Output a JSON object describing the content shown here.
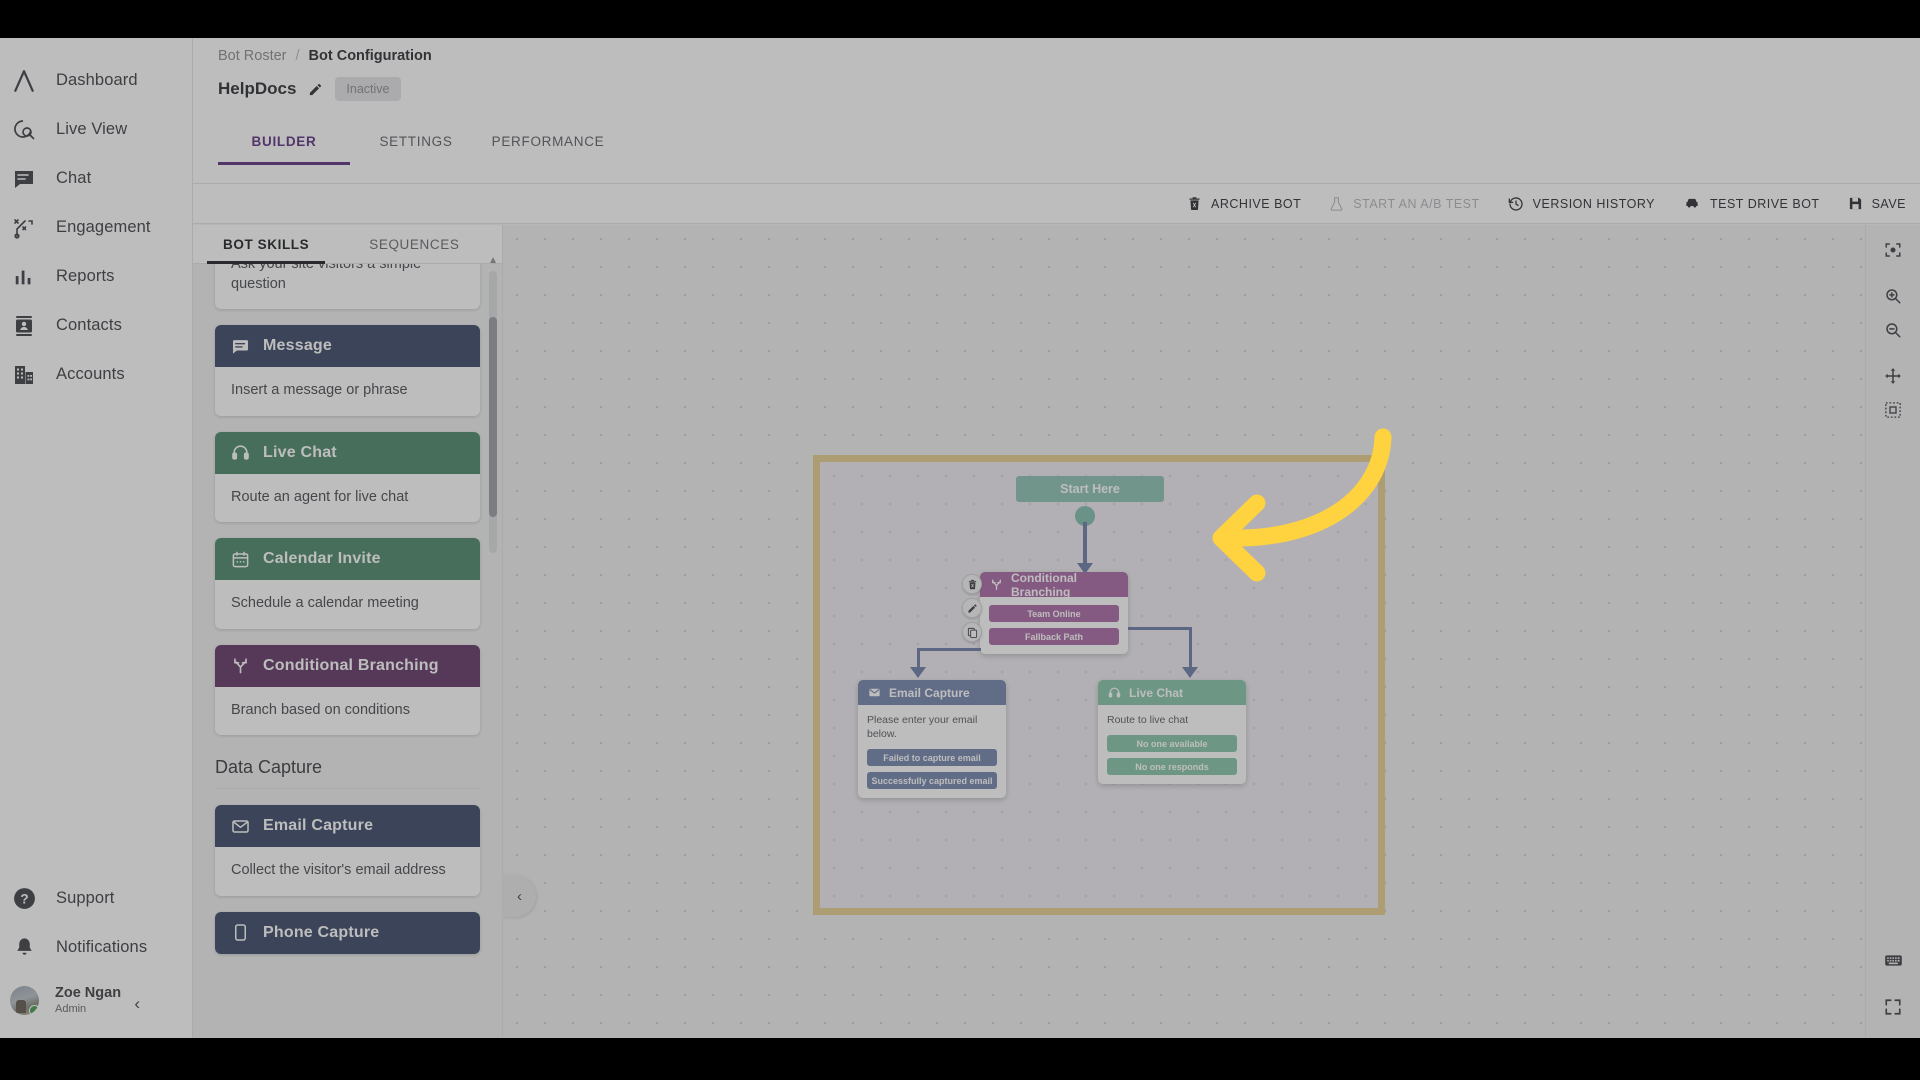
{
  "sidebar": {
    "nav_items": [
      {
        "label": "Dashboard",
        "icon": "logo-caret-icon"
      },
      {
        "label": "Live View",
        "icon": "live-view-icon"
      },
      {
        "label": "Chat",
        "icon": "chat-bubble-icon"
      },
      {
        "label": "Engagement",
        "icon": "engagement-icon"
      },
      {
        "label": "Reports",
        "icon": "bar-chart-icon"
      },
      {
        "label": "Contacts",
        "icon": "contact-card-icon"
      },
      {
        "label": "Accounts",
        "icon": "building-icon"
      }
    ],
    "bottom_items": [
      {
        "label": "Support",
        "icon": "help-circle-icon"
      },
      {
        "label": "Notifications",
        "icon": "bell-icon"
      }
    ],
    "user": {
      "name": "Zoe Ngan",
      "role": "Admin",
      "status": "online"
    },
    "collapse_label": "‹"
  },
  "header": {
    "breadcrumb": {
      "parent": "Bot Roster",
      "separator": "/",
      "current": "Bot Configuration"
    },
    "bot_name": "HelpDocs",
    "status_badge": "Inactive",
    "tabs": [
      {
        "label": "BUILDER",
        "active": true
      },
      {
        "label": "SETTINGS",
        "active": false
      },
      {
        "label": "PERFORMANCE",
        "active": false
      }
    ],
    "accent_color": "#8322d6"
  },
  "actionbar": {
    "actions": [
      {
        "label": "ARCHIVE BOT",
        "icon": "trash-icon",
        "disabled": false
      },
      {
        "label": "START AN A/B TEST",
        "icon": "flask-icon",
        "disabled": true
      },
      {
        "label": "VERSION HISTORY",
        "icon": "history-clock-icon",
        "disabled": false
      },
      {
        "label": "TEST DRIVE BOT",
        "icon": "car-icon",
        "disabled": false
      },
      {
        "label": "SAVE",
        "icon": "floppy-disk-icon",
        "disabled": false
      }
    ]
  },
  "left_panel": {
    "tabs": [
      {
        "label": "BOT SKILLS",
        "active": true
      },
      {
        "label": "SEQUENCES",
        "active": false
      }
    ],
    "skills": [
      {
        "title": "",
        "description": "Ask your site visitors a simple question",
        "color": "#2e4c8d",
        "icon": "question-icon",
        "partial": true
      },
      {
        "title": "Message",
        "description": "Insert a message or phrase",
        "color": "#2e4c8d",
        "icon": "message-icon",
        "partial": false
      },
      {
        "title": "Live Chat",
        "description": "Route an agent for live chat",
        "color": "#179b5e",
        "icon": "headset-icon",
        "partial": false
      },
      {
        "title": "Calendar Invite",
        "description": "Schedule a calendar meeting",
        "color": "#179b5e",
        "icon": "calendar-icon",
        "partial": false
      },
      {
        "title": "Conditional Branching",
        "description": "Branch based on conditions",
        "color": "#8c2b96",
        "icon": "branch-icon",
        "partial": false
      }
    ],
    "section_title": "Data Capture",
    "data_capture_skills": [
      {
        "title": "Email Capture",
        "description": "Collect the visitor's email address",
        "color": "#2e4c8d",
        "icon": "envelope-icon",
        "partial": false
      },
      {
        "title": "Phone Capture",
        "description": "",
        "color": "#2e4c8d",
        "icon": "phone-icon",
        "partial": true
      }
    ]
  },
  "canvas": {
    "collapse_label": "‹",
    "highlight_color": "#ffd23f",
    "annotation": {
      "type": "curved-arrow",
      "color": "#ffd23f",
      "direction": "left"
    },
    "flow": {
      "start": {
        "label": "Start Here",
        "color": "#5ed3b0"
      },
      "nodes": [
        {
          "id": "conditional-branching",
          "title": "Conditional Branching",
          "color": "#e356db",
          "icon": "branch-icon",
          "body_text": "",
          "pills": [
            {
              "label": "Team Online",
              "color": "#e356db"
            },
            {
              "label": "Fallback Path",
              "color": "#e356db"
            }
          ],
          "tools": [
            "trash-icon",
            "pencil-icon",
            "duplicate-icon"
          ]
        },
        {
          "id": "email-capture",
          "title": "Email Capture",
          "color": "#6287e0",
          "icon": "envelope-icon",
          "body_text": "Please enter your email below.",
          "pills": [
            {
              "label": "Failed to capture email",
              "color": "#6287e0"
            },
            {
              "label": "Successfully captured email",
              "color": "#6287e0"
            }
          ],
          "tools": []
        },
        {
          "id": "live-chat",
          "title": "Live Chat",
          "color": "#4ed99a",
          "icon": "headset-icon",
          "body_text": "Route to live chat",
          "pills": [
            {
              "label": "No one available",
              "color": "#4ed99a"
            },
            {
              "label": "No one responds",
              "color": "#4ed99a"
            }
          ],
          "tools": []
        }
      ]
    }
  },
  "right_toolbar": {
    "buttons": [
      {
        "icon": "center-focus-icon",
        "name": "fit-to-view-button"
      },
      {
        "icon": "zoom-in-icon",
        "name": "zoom-in-button"
      },
      {
        "icon": "zoom-out-icon",
        "name": "zoom-out-button"
      },
      {
        "icon": "move-icon",
        "name": "pan-button"
      },
      {
        "icon": "selection-box-icon",
        "name": "select-region-button"
      }
    ],
    "bottom_buttons": [
      {
        "icon": "keyboard-icon",
        "name": "keyboard-shortcuts-button"
      },
      {
        "icon": "fullscreen-icon",
        "name": "fullscreen-button"
      }
    ]
  }
}
